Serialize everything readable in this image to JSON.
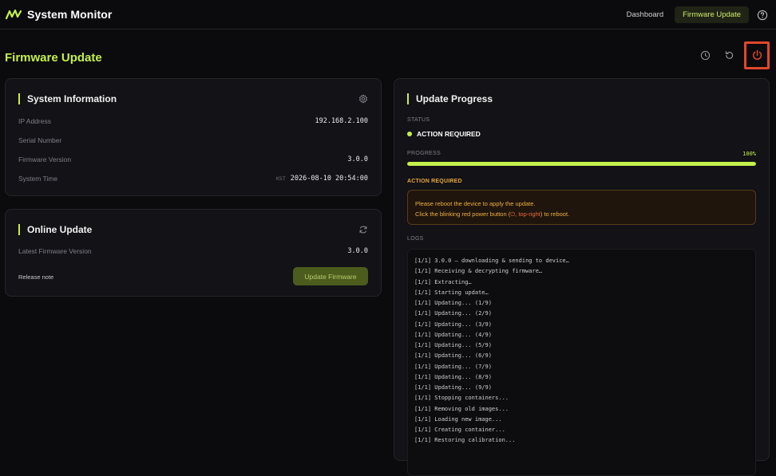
{
  "app": {
    "title": "System Monitor"
  },
  "nav": {
    "dashboard": "Dashboard",
    "firmware_update": "Firmware Update"
  },
  "page": {
    "title": "Firmware Update"
  },
  "system_info": {
    "title": "System Information",
    "rows": [
      {
        "label": "IP Address",
        "value": "192.168.2.100"
      },
      {
        "label": "Serial Number",
        "value": ""
      },
      {
        "label": "Firmware Version",
        "value": "3.0.0"
      },
      {
        "label": "System Time",
        "tz": "KST",
        "value": "2026-08-10 20:54:00"
      }
    ]
  },
  "online_update": {
    "title": "Online Update",
    "latest_label": "Latest Firmware Version",
    "latest_value": "3.0.0",
    "release_note": "Release note",
    "button": "Update Firmware"
  },
  "progress": {
    "title": "Update Progress",
    "status_label": "STATUS",
    "status_text": "ACTION REQUIRED",
    "progress_label": "PROGRESS",
    "percent_text": "100%",
    "percent": 100,
    "action_label": "ACTION REQUIRED",
    "alert_line1": "Please reboot the device to apply the update.",
    "alert_line2_pre": "Click the blinking red power button (",
    "alert_line2_hl": "⏻, top-right",
    "alert_line2_post": ") to reboot.",
    "logs_label": "LOGS",
    "logs": [
      "[1/1] 3.0.0 — downloading & sending to device…",
      "[1/1] Receiving & decrypting firmware…",
      "[1/1] Extracting…",
      "[1/1] Starting update…",
      "[1/1] Updating... (1/9)",
      "[1/1] Updating... (2/9)",
      "[1/1] Updating... (3/9)",
      "[1/1] Updating... (4/9)",
      "[1/1] Updating... (5/9)",
      "[1/1] Updating... (6/9)",
      "[1/1] Updating... (7/9)",
      "[1/1] Updating... (8/9)",
      "[1/1] Updating... (9/9)",
      "[1/1] Stopping containers...",
      "[1/1] Removing old images...",
      "[1/1] Loading new image...",
      "[1/1] Creating container...",
      "[1/1] Restoring calibration..."
    ]
  },
  "icons": {
    "logo": "wave-logo-icon",
    "help": "help-circle-icon",
    "history": "clock-icon",
    "undo": "rotate-ccw-icon",
    "power": "power-icon",
    "settings": "gear-icon",
    "refresh": "refresh-icon"
  },
  "colors": {
    "accent": "#c5f04a",
    "warning": "#f0b042",
    "danger": "#e2472a",
    "background": "#0b0b0e"
  }
}
